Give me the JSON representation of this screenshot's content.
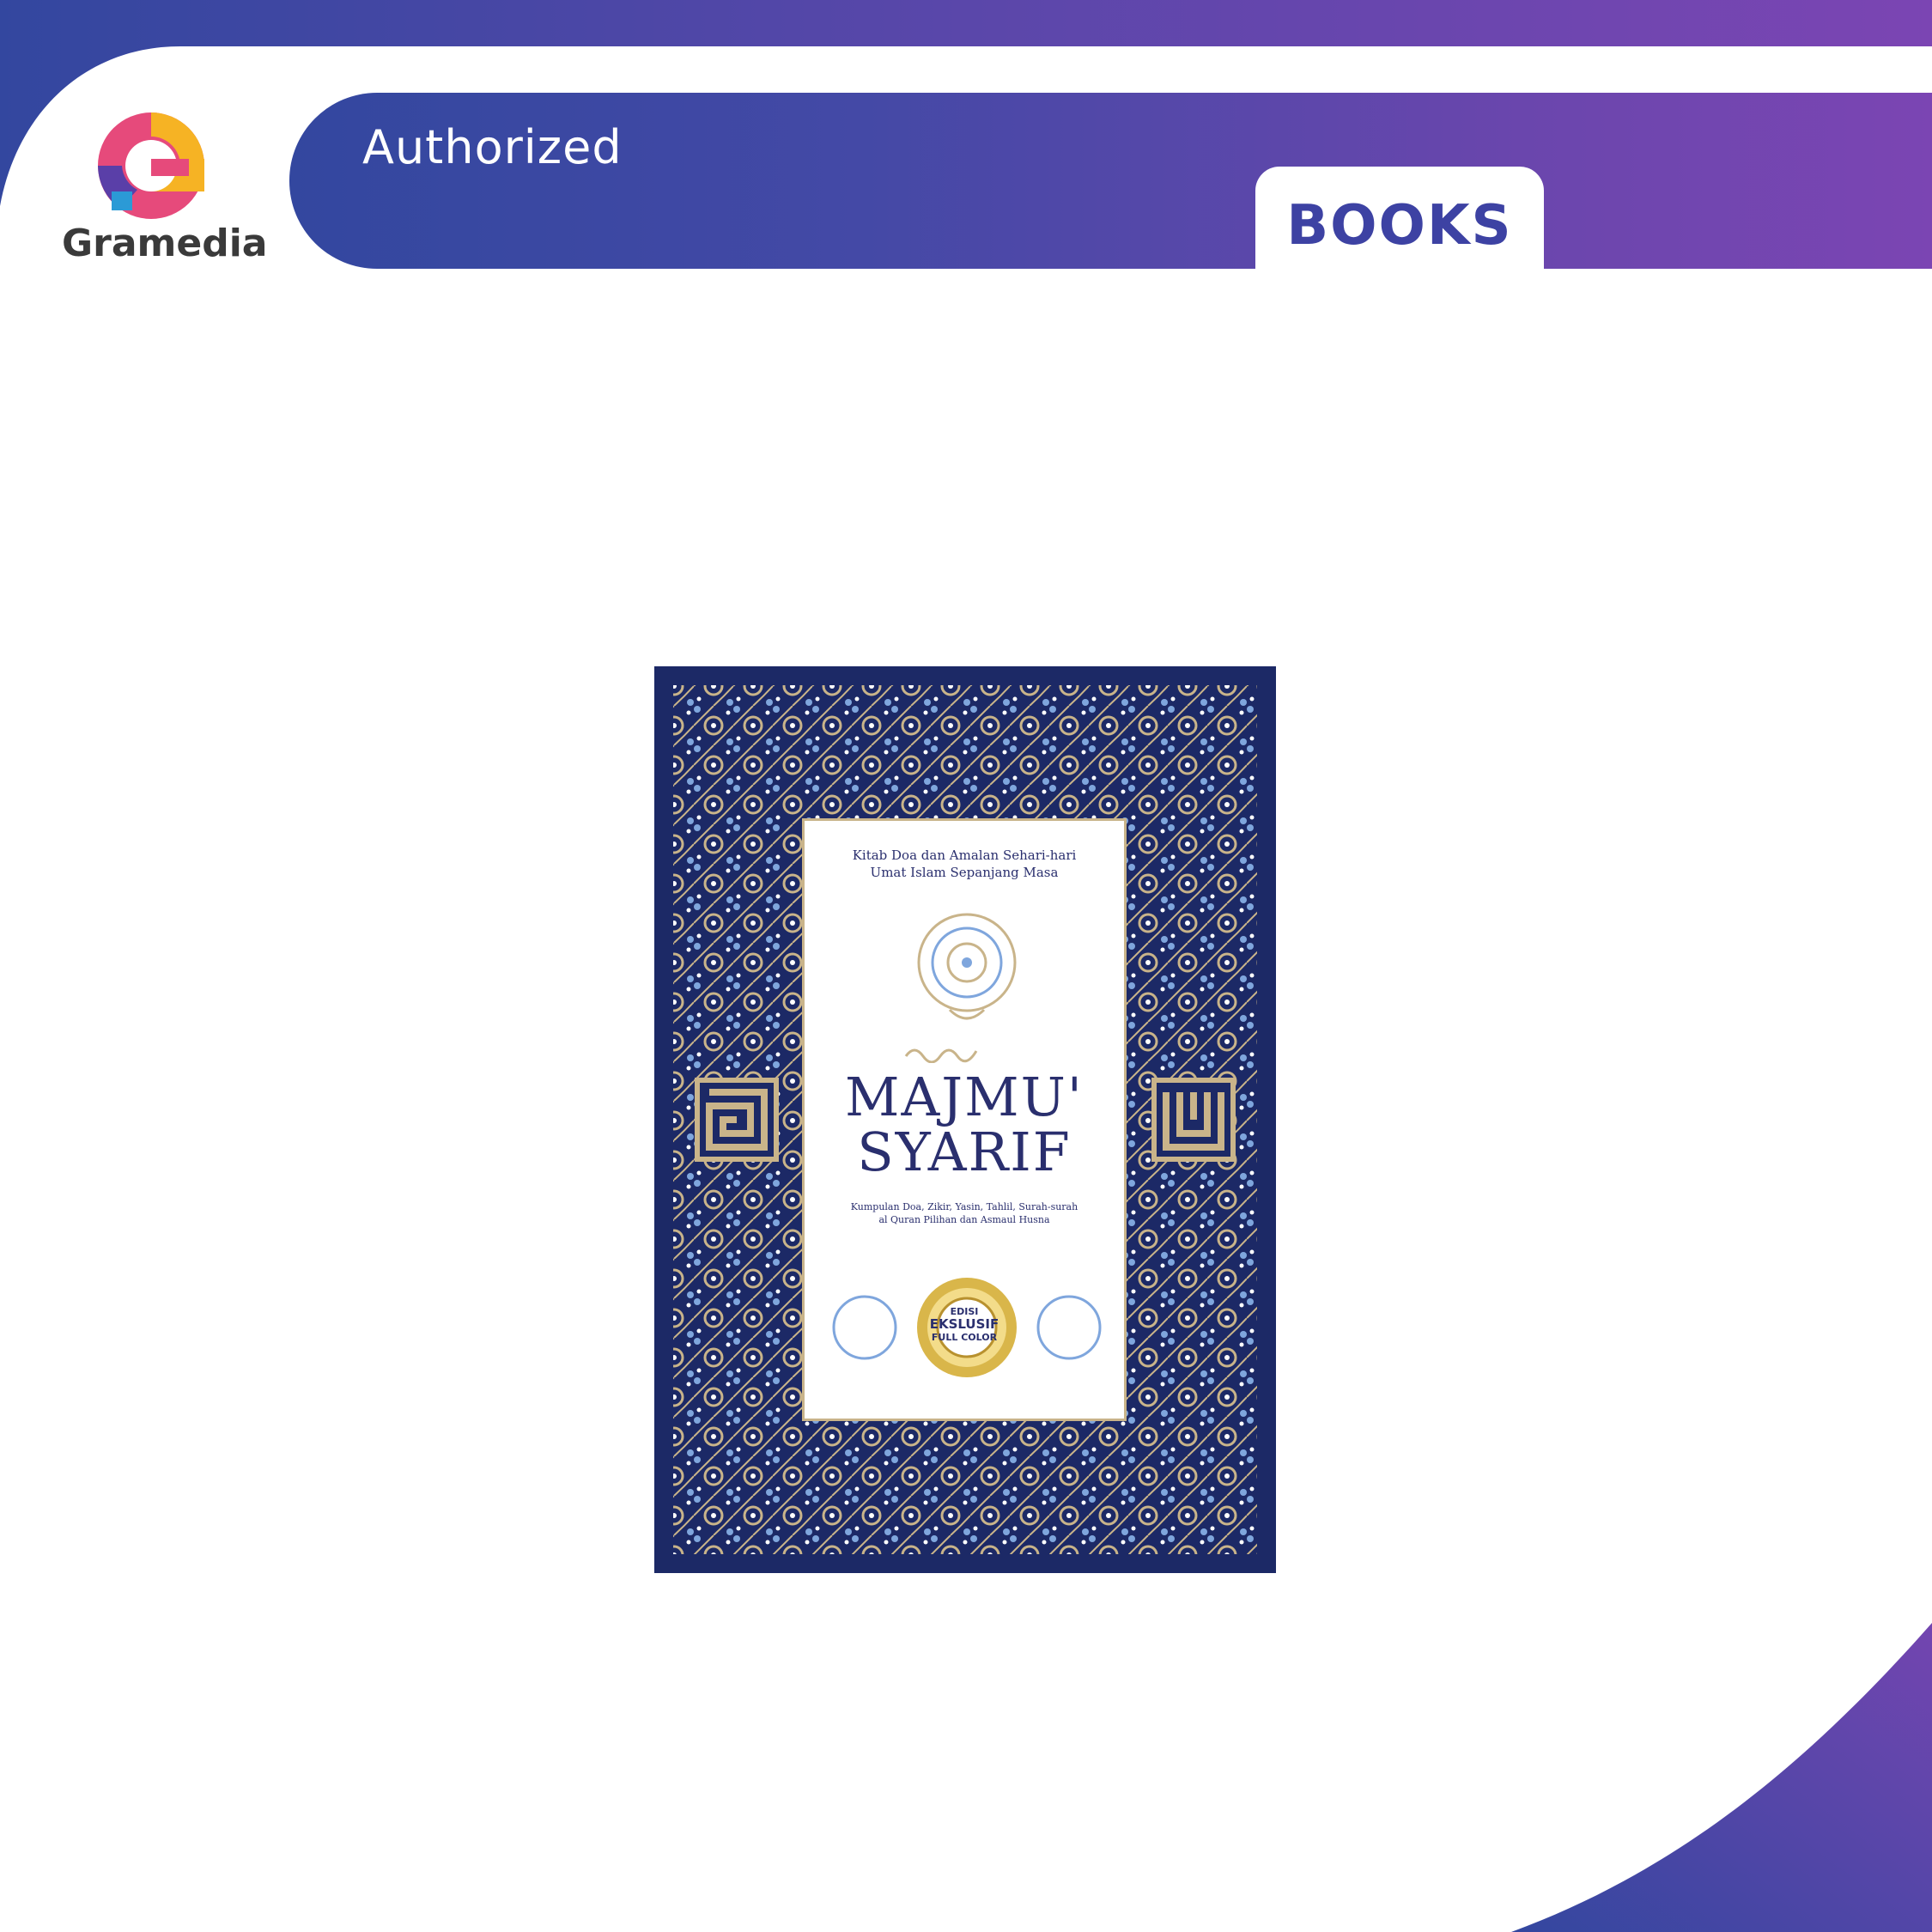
{
  "brand": {
    "name": "Gramedia"
  },
  "header": {
    "badge_label": "Authorized",
    "category_tab": "BOOKS"
  },
  "product": {
    "cover": {
      "kicker": [
        "Kitab Doa dan Amalan Sehari-hari",
        "Umat Islam Sepanjang Masa"
      ],
      "title_line1": "MAJMU'",
      "title_line2": "SYARIF",
      "subtitle": [
        "Kumpulan Doa, Zikir, Yasin, Tahlil, Surah-surah",
        "al Quran Pilihan dan Asmaul Husna"
      ],
      "seal": [
        "EDISI",
        "EKSLUSIF",
        "FULL COLOR"
      ]
    }
  },
  "colors": {
    "brand_blue": "#3d42a3",
    "gradient_start": "#33479f",
    "gradient_end": "#7b45b3",
    "cover_navy": "#1c2966",
    "cover_gold": "#c9b48a"
  }
}
